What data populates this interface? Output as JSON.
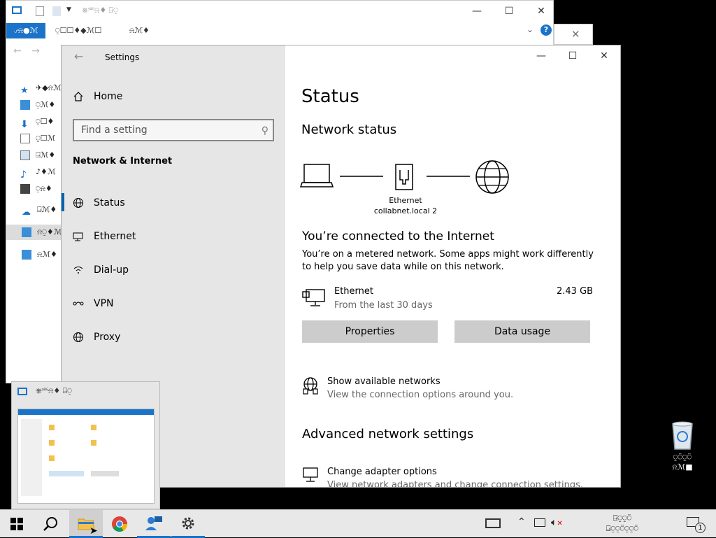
{
  "explorer": {
    "title": "⎈⎃⍾♦ ⍈⍜",
    "ribbon_tabs": [
      "⍻⍾●ℳ",
      "⍜☐☐♦◆ℳ☐",
      "⍾ℳ♦"
    ],
    "nav_items": [
      "✈◆⍾ℳ",
      "⍜ℳ♦",
      "⍜☐♦",
      "⍜☐ℳ",
      "⍈ℳ♦",
      "♪♦ℳ",
      "⍜⍾♦",
      "⍈ℳ♦",
      "⍾⍜♦ℳ",
      "⍾ℳ♦"
    ]
  },
  "settings": {
    "window_title": "Settings",
    "home_label": "Home",
    "search_placeholder": "Find a setting",
    "section_title": "Network & Internet",
    "menu": [
      {
        "label": "Status",
        "icon": "globe-status-icon"
      },
      {
        "label": "Ethernet",
        "icon": "ethernet-icon"
      },
      {
        "label": "Dial-up",
        "icon": "dialup-icon"
      },
      {
        "label": "VPN",
        "icon": "vpn-icon"
      },
      {
        "label": "Proxy",
        "icon": "globe-icon"
      }
    ],
    "page_title": "Status",
    "network_status_heading": "Network status",
    "diagram_label_line1": "Ethernet",
    "diagram_label_line2": "collabnet.local 2",
    "connected_heading": "You’re connected to the Internet",
    "metered_text": "You’re on a metered network. Some apps might work differently to help you save data while on this network.",
    "adapter_name": "Ethernet",
    "adapter_sub": "From the last 30 days",
    "data_amount": "2.43 GB",
    "properties_button": "Properties",
    "data_usage_button": "Data usage",
    "show_networks_title": "Show available networks",
    "show_networks_sub": "View the connection options around you.",
    "advanced_heading": "Advanced network settings",
    "change_adapter_title": "Change adapter options",
    "change_adapter_sub": "View network adapters and change connection settings."
  },
  "desktop": {
    "recycle_label_line1": "⍜⍥⍜⍥",
    "recycle_label_line2": "⍾ℳ■"
  },
  "taskbar": {
    "tray_time": "⍈⍜⍜⍥",
    "tray_date": "⍈⍜⍜⍥⍜⍜⍥",
    "notification_count": "1"
  },
  "thumbnail": {
    "title": "⎈⎃⍾♦ ⍈⍜"
  },
  "colors": {
    "accent": "#0063b1",
    "sidebar_bg": "#e6e6e6",
    "button_bg": "#cccccc"
  }
}
